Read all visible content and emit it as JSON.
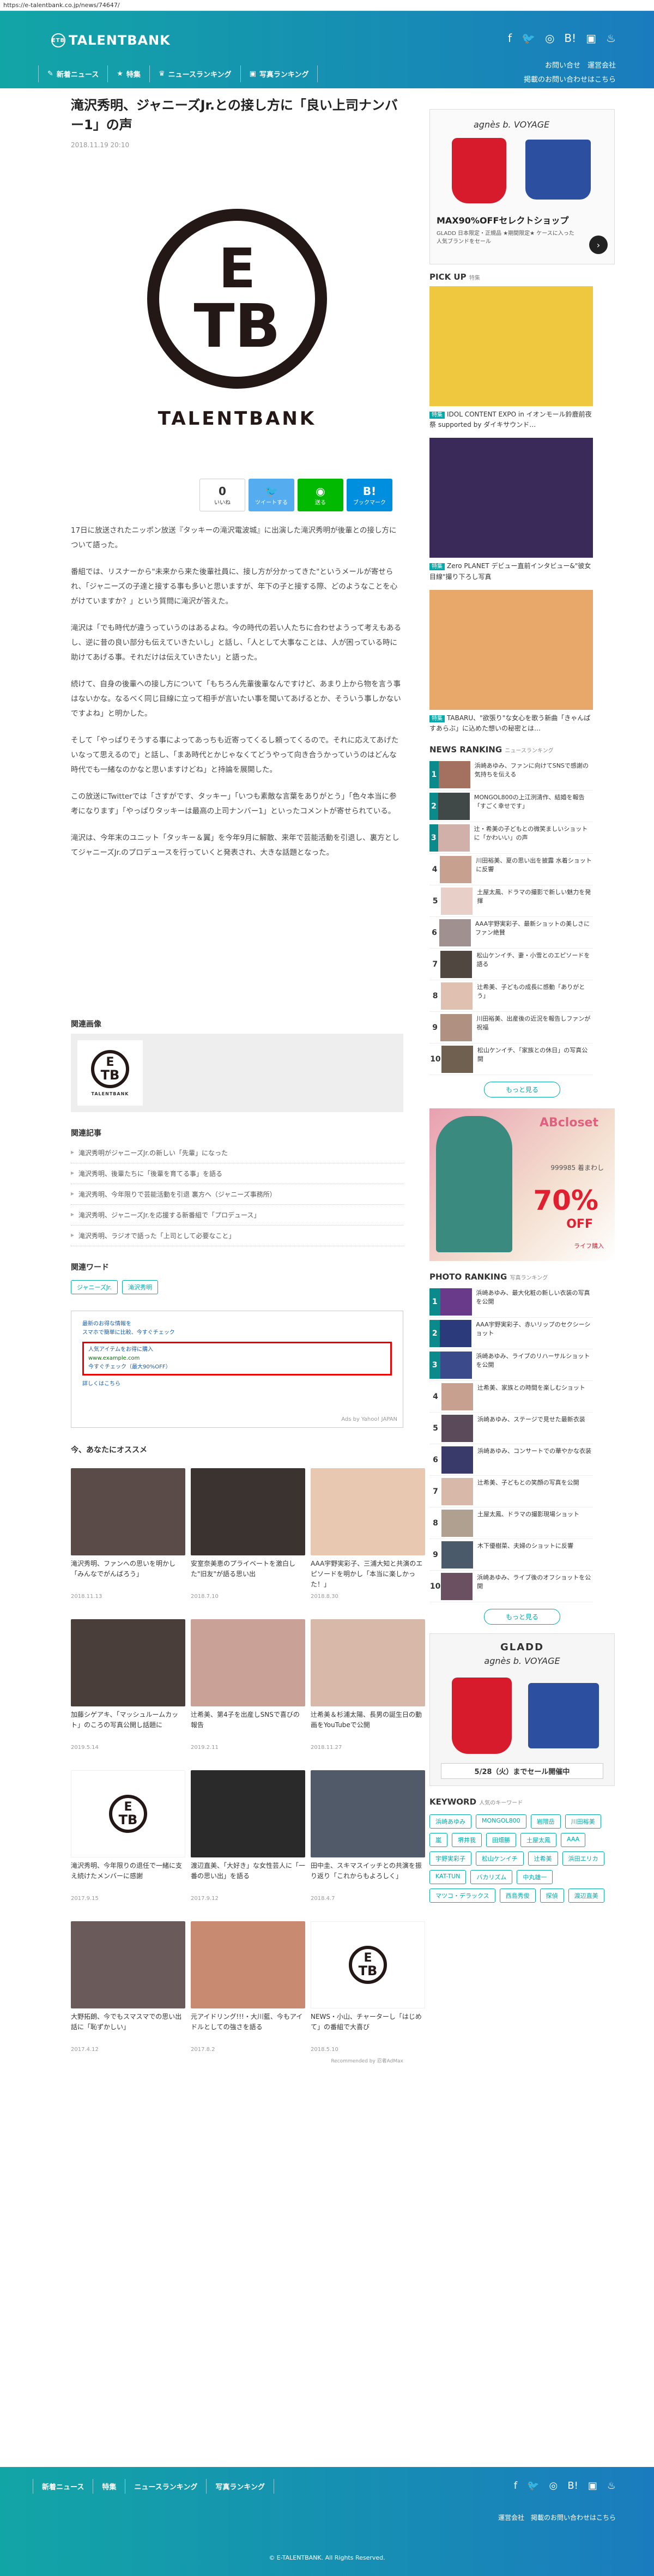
{
  "url": "https://e-talentbank.co.jp/news/74647/",
  "header": {
    "logo_text": "TALENTBANK",
    "logo_mark": "ETB",
    "links": [
      "お問い合せ",
      "運営会社",
      "掲載のお問い合わせはこちら"
    ],
    "nav": [
      {
        "icon": "✎",
        "label": "新着ニュース"
      },
      {
        "icon": "★",
        "label": "特集"
      },
      {
        "icon": "♛",
        "label": "ニュースランキング"
      },
      {
        "icon": "▣",
        "label": "写真ランキング"
      }
    ]
  },
  "article": {
    "title": "滝沢秀明、ジャニーズJr.との接し方に「良い上司ナンバー1」の声",
    "date": "2018.11.19 20:10",
    "hero": {
      "e": "E",
      "tb": "TB",
      "word": "TALENTBANK"
    },
    "share": [
      {
        "count": "0",
        "label": "いいね",
        "color": "#ffffff",
        "text_color": "#333"
      },
      {
        "count": "",
        "label": "ツイートする",
        "color": "#55acee",
        "text_color": "#fff"
      },
      {
        "count": "",
        "label": "送る",
        "color": "#00b900",
        "text_color": "#fff"
      },
      {
        "count": "B!",
        "label": "ブックマーク",
        "color": "#008fde",
        "text_color": "#fff"
      }
    ],
    "paragraphs": [
      "17日に放送されたニッポン放送『タッキーの滝沢電波城』に出演した滝沢秀明が後輩との接し方について語った。",
      "番組では、リスナーから\"未来から来た後輩社員に、接し方が分かってきた\"というメールが寄せられ、「ジャニーズの子達と接する事も多いと思いますが、年下の子と接する際、どのようなことを心がけていますか？」という質問に滝沢が答えた。",
      "滝沢は「でも時代が違うっていうのはあるよね。今の時代の若い人たちに合わせようって考えもあるし、逆に昔の良い部分も伝えていきたいし」と話し、「人として大事なことは、人が困っている時に助けてあげる事。それだけは伝えていきたい」と語った。",
      "続けて、自身の後輩への接し方について「もちろん先輩後輩なんですけど、あまり上から物を言う事はないかな。なるべく同じ目線に立って相手が言いたい事を聞いてあげるとか、そういう事しかないですよね」と明かした。",
      "そして「やっぱりそうする事によってあっちも近寄ってくるし頼ってくるので。それに応えてあげたいなって思えるので」と話し、「まあ時代とかじゃなくてどうやって向き合うかっていうのはどんな時代でも一緒なのかなと思いますけどね」と持論を展開した。",
      "この放送にTwitterでは「さすがです、タッキー」「いつも素敵な言葉をありがとう」「色々本当に参考になります」「やっぱりタッキーは最高の上司ナンバー1」といったコメントが寄せられている。",
      "滝沢は、今年末のユニット「タッキー＆翼」を今年9月に解散、来年で芸能活動を引退し、裏方としてジャニーズJr.のプロデュースを行っていくと発表され、大きな話題となった。"
    ],
    "related_image_heading": "関連画像",
    "related_news_heading": "関連記事",
    "related_news": [
      "滝沢秀明がジャニーズJr.の新しい「先輩」になった",
      "滝沢秀明、後輩たちに「後輩を育てる事」を語る",
      "滝沢秀明、今年限りで芸能活動を引退 裏方へ（ジャニーズ事務所）",
      "滝沢秀明、ジャニーズJr.を応援する新番組で「プロデュース」",
      "滝沢秀明、ラジオで語った「上司として必要なこと」"
    ],
    "tags_heading": "関連ワード",
    "tags": [
      "ジャニーズJr.",
      "滝沢秀明"
    ],
    "ad": {
      "lines": [
        "最新のお得な情報を",
        "スマホで簡単に比較、今すぐチェック"
      ],
      "highlight": [
        "人気アイテムをお得に購入",
        "www.example.com",
        "今すぐチェック（最大90%OFF）"
      ],
      "footer_link": "詳しくはこちら",
      "ads_by": "Ads by Yahoo! JAPAN"
    },
    "recs_heading": "今、あなたにオススメ",
    "recs": [
      {
        "title": "滝沢秀明、ファンへの思いを明かし「みんなでがんばろう」",
        "date": "2018.11.13",
        "color": "#5a4a48"
      },
      {
        "title": "安室奈美恵のプライベートを激白した\"旧友\"が語る思い出",
        "date": "2018.7.10",
        "color": "#3a3330"
      },
      {
        "title": "AAA宇野実彩子、三浦大知と共演のエピソードを明かし「本当に楽しかった！」",
        "date": "2018.8.30",
        "color": "#e8c8b0"
      },
      {
        "title": "加藤シゲアキ、「マッシュルームカット」のころの写真公開し話題に",
        "date": "2019.5.14",
        "color": "#4a3e3a"
      },
      {
        "title": "辻希美、第4子を出産しSNSで喜びの報告",
        "date": "2019.2.11",
        "color": "#c9a196"
      },
      {
        "title": "辻希美＆杉浦太陽、長男の誕生日の動画をYouTubeで公開",
        "date": "2018.11.27",
        "color": "#d8b8a8"
      },
      {
        "title": "滝沢秀明、今年限りの退任で一緒に支え続けたメンバーに感謝",
        "date": "2017.9.15",
        "color": "#ffffff"
      },
      {
        "title": "渡辺直美、「大好き」な女性芸人に「一番の思い出」を語る",
        "date": "2017.9.12",
        "color": "#2a2a2a"
      },
      {
        "title": "田中圭、スキマスイッチとの共演を振り返り「これからもよろしく」",
        "date": "2018.4.7",
        "color": "#505a68"
      },
      {
        "title": "大野拓朗、今でもスマスマでの思い出話に「恥ずかしい」",
        "date": "2017.4.12",
        "color": "#6a5a5a"
      },
      {
        "title": "元アイドリング!!!・大川藍、今もアイドルとしての強さを語る",
        "date": "2017.8.2",
        "color": "#c88a70"
      },
      {
        "title": "NEWS・小山、チャーターし「はじめて」の番組で大喜び",
        "date": "2018.5.10",
        "color": "#ffffff"
      }
    ],
    "recs_footer": "Recommended by 忍者AdMax"
  },
  "sidebar": {
    "top_ad": {
      "brand": "agnès b. VOYAGE",
      "title": "MAX90%OFFセレクトショップ",
      "sub": "GLADD 日本限定・正規品 ★期間限定★ ケースに入った人気ブランドをセール",
      "arrow": "›"
    },
    "pickup_heading": "PICK UP",
    "pickup_sub": "特集",
    "pickup": [
      {
        "badge": "特集",
        "caption": "IDOL CONTENT EXPO in イオンモール鈴鹿前夜祭 supported by ダイキサウンド…",
        "color": "#f0c840"
      },
      {
        "badge": "特集",
        "caption": "Zero PLANET デビュー直前インタビュー&\"彼女目線\"撮り下ろし写真",
        "color": "#3a2a5a"
      },
      {
        "badge": "特集",
        "caption": "TABARU、\"欲張り\"な女心を歌う新曲「きゃんぱすあらぶ」に込めた想いの秘密とは…",
        "color": "#e8a86a"
      }
    ],
    "news_rank_heading": "NEWS RANKING",
    "news_rank_sub": "ニュースランキング",
    "news_rank": [
      {
        "n": "1",
        "title": "浜崎あゆみ、ファンに向けてSNSで感謝の気持ちを伝える",
        "color": "#a47060"
      },
      {
        "n": "2",
        "title": "MONGOL800の上江洌清作、結婚を報告「すごく幸せです」",
        "color": "#404848"
      },
      {
        "n": "3",
        "title": "辻・希美の子どもとの微笑ましいショットに「かわいい」の声",
        "color": "#d0b0a8"
      },
      {
        "n": "4",
        "title": "川田裕美、夏の思い出を披露 水着ショットに反響",
        "color": "#c8a090"
      },
      {
        "n": "5",
        "title": "土屋太鳳、ドラマの撮影で新しい魅力を発揮",
        "color": "#e8d0c8"
      },
      {
        "n": "6",
        "title": "AAA宇野実彩子、最新ショットの美しさにファン絶賛",
        "color": "#a09090"
      },
      {
        "n": "7",
        "title": "松山ケンイチ、妻・小雪とのエピソードを語る",
        "color": "#504840"
      },
      {
        "n": "8",
        "title": "辻希美、子どもの成長に感動「ありがとう」",
        "color": "#e0c0b0"
      },
      {
        "n": "9",
        "title": "川田裕美、出産後の近況を報告しファンが祝福",
        "color": "#b09080"
      },
      {
        "n": "10",
        "title": "松山ケンイチ、「家族との休日」の写真公開",
        "color": "#706050"
      }
    ],
    "more_label": "もっと見る",
    "banner": {
      "brand": "ABcloset",
      "pct": "70%",
      "off": "OFF",
      "line": "999985 着まわし",
      "sub": "ライフ購入",
      "color": "#3cb5a8"
    },
    "photo_rank_heading": "PHOTO RANKING",
    "photo_rank_sub": "写真ランキング",
    "photo_rank": [
      {
        "n": "1",
        "title": "浜崎あゆみ、最大化粧の新しい衣装の写真を公開",
        "color": "#6a3a8a"
      },
      {
        "n": "2",
        "title": "AAA宇野実彩子、赤いリップのセクシーショット",
        "color": "#2a3a7a"
      },
      {
        "n": "3",
        "title": "浜崎あゆみ、ライブのリハーサルショットを公開",
        "color": "#3a4a8a"
      },
      {
        "n": "4",
        "title": "辻希美、家族との時間を楽しむショット",
        "color": "#c8a090"
      },
      {
        "n": "5",
        "title": "浜崎あゆみ、ステージで見せた最新衣装",
        "color": "#5a4a5a"
      },
      {
        "n": "6",
        "title": "浜崎あゆみ、コンサートでの華やかな衣装",
        "color": "#3a3a6a"
      },
      {
        "n": "7",
        "title": "辻希美、子どもとの笑顔の写真を公開",
        "color": "#d8b8a8"
      },
      {
        "n": "8",
        "title": "土屋太鳳、ドラマの撮影現場ショット",
        "color": "#b0a090"
      },
      {
        "n": "9",
        "title": "木下優樹菜、夫婦のショットに反響",
        "color": "#4a5a6a"
      },
      {
        "n": "10",
        "title": "浜崎あゆみ、ライブ後のオフショットを公開",
        "color": "#6a5060"
      }
    ],
    "gladd_ad": {
      "brand": "GLADD",
      "sub": "agnès b. VOYAGE",
      "date": "5/28（火）までセール開催中"
    },
    "keyword_heading": "KEYWORD",
    "keyword_sub": "人気のキーワード",
    "keywords": [
      "浜崎あゆみ",
      "MONGOL800",
      "岩隈岳",
      "川田裕美",
      "嵐",
      "堺井我",
      "田畑勝",
      "土屋太鳳",
      "AAA",
      "宇野実彩子",
      "松山ケンイチ",
      "辻希美",
      "浜田エリカ",
      "KAT-TUN",
      "バカリズム",
      "中丸雄一",
      "マツコ・デラックス",
      "西島秀俊",
      "探偵",
      "渡辺直美"
    ]
  },
  "footer": {
    "nav": [
      "新着ニュース",
      "特集",
      "ニュースランキング",
      "写真ランキング"
    ],
    "links": "運営会社　掲載のお問い合わせはこちら",
    "copyright": "© E-TALENTBANK. All Rights Reserved."
  }
}
